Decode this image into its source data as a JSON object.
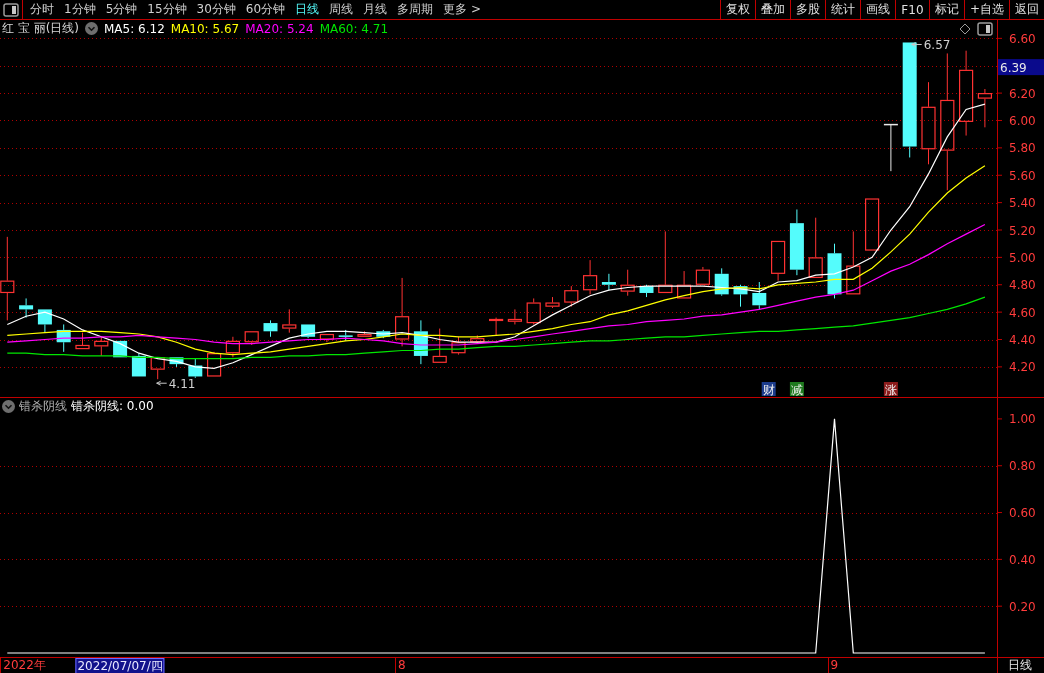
{
  "toolbar": {
    "periods": [
      {
        "label": "分时",
        "selected": false
      },
      {
        "label": "1分钟",
        "selected": false
      },
      {
        "label": "5分钟",
        "selected": false
      },
      {
        "label": "15分钟",
        "selected": false
      },
      {
        "label": "30分钟",
        "selected": false
      },
      {
        "label": "60分钟",
        "selected": false
      },
      {
        "label": "日线",
        "selected": true
      },
      {
        "label": "周线",
        "selected": false
      },
      {
        "label": "月线",
        "selected": false
      },
      {
        "label": "多周期",
        "selected": false
      },
      {
        "label": "更多 >",
        "selected": false
      }
    ],
    "buttons": [
      "复权",
      "叠加",
      "多股",
      "统计",
      "画线",
      "F10",
      "标记",
      "+自选",
      "返回"
    ]
  },
  "price_panel": {
    "title": "红 宝 丽(日线)",
    "price_tag": "6.39",
    "event_tags": [
      {
        "label": "财",
        "color": "#1c3c8c"
      },
      {
        "label": "减",
        "color": "#1f7a1f"
      },
      {
        "label": "涨",
        "color": "#8c1c1c"
      }
    ],
    "chart_data": {
      "type": "candlestick",
      "ylim": [
        3.98,
        6.61
      ],
      "grid": true,
      "yticks": [
        {
          "value": 6.6,
          "label": "6.60"
        },
        {
          "value": 6.2,
          "label": "6.20"
        },
        {
          "value": 6.0,
          "label": "6.00"
        },
        {
          "value": 5.8,
          "label": "5.80"
        },
        {
          "value": 5.6,
          "label": "5.60"
        },
        {
          "value": 5.4,
          "label": "5.40"
        },
        {
          "value": 5.2,
          "label": "5.20"
        },
        {
          "value": 5.0,
          "label": "5.00"
        },
        {
          "value": 4.8,
          "label": "4.80"
        },
        {
          "value": 4.6,
          "label": "4.60"
        },
        {
          "value": 4.4,
          "label": "4.40"
        },
        {
          "value": 4.2,
          "label": "4.20"
        }
      ],
      "ohlc": [
        [
          4.74,
          5.15,
          4.54,
          4.83
        ],
        [
          4.65,
          4.7,
          4.56,
          4.62
        ],
        [
          4.62,
          4.62,
          4.45,
          4.51
        ],
        [
          4.47,
          4.51,
          4.31,
          4.38
        ],
        [
          4.33,
          4.45,
          4.33,
          4.36
        ],
        [
          4.35,
          4.42,
          4.28,
          4.39
        ],
        [
          4.39,
          4.39,
          4.27,
          4.27
        ],
        [
          4.28,
          4.3,
          4.13,
          4.13
        ],
        [
          4.18,
          4.27,
          4.11,
          4.27
        ],
        [
          4.27,
          4.27,
          4.2,
          4.22
        ],
        [
          4.21,
          4.26,
          4.12,
          4.13
        ],
        [
          4.13,
          4.31,
          4.13,
          4.3
        ],
        [
          4.3,
          4.42,
          4.27,
          4.39
        ],
        [
          4.38,
          4.46,
          4.36,
          4.46
        ],
        [
          4.52,
          4.54,
          4.42,
          4.46
        ],
        [
          4.48,
          4.62,
          4.45,
          4.51
        ],
        [
          4.51,
          4.51,
          4.41,
          4.42
        ],
        [
          4.4,
          4.44,
          4.38,
          4.44
        ],
        [
          4.43,
          4.47,
          4.39,
          4.42
        ],
        [
          4.42,
          4.46,
          4.42,
          4.44
        ],
        [
          4.46,
          4.47,
          4.41,
          4.42
        ],
        [
          4.4,
          4.85,
          4.35,
          4.57
        ],
        [
          4.46,
          4.54,
          4.22,
          4.28
        ],
        [
          4.23,
          4.48,
          4.23,
          4.28
        ],
        [
          4.3,
          4.42,
          4.29,
          4.38
        ],
        [
          4.38,
          4.43,
          4.37,
          4.41
        ],
        [
          4.54,
          4.56,
          4.43,
          4.55
        ],
        [
          4.53,
          4.62,
          4.51,
          4.55
        ],
        [
          4.52,
          4.7,
          4.51,
          4.67
        ],
        [
          4.64,
          4.71,
          4.63,
          4.67
        ],
        [
          4.67,
          4.79,
          4.64,
          4.76
        ],
        [
          4.76,
          4.98,
          4.73,
          4.87
        ],
        [
          4.82,
          4.88,
          4.76,
          4.8
        ],
        [
          4.75,
          4.91,
          4.72,
          4.8
        ],
        [
          4.79,
          4.8,
          4.71,
          4.74
        ],
        [
          4.74,
          5.19,
          4.74,
          4.8
        ],
        [
          4.7,
          4.9,
          4.7,
          4.8
        ],
        [
          4.8,
          4.93,
          4.8,
          4.91
        ],
        [
          4.88,
          4.92,
          4.72,
          4.73
        ],
        [
          4.79,
          4.8,
          4.64,
          4.73
        ],
        [
          4.74,
          4.82,
          4.62,
          4.65
        ],
        [
          4.88,
          5.12,
          4.83,
          5.12
        ],
        [
          5.25,
          5.35,
          4.87,
          4.91
        ],
        [
          4.85,
          5.29,
          4.85,
          5.0
        ],
        [
          5.03,
          5.1,
          4.7,
          4.73
        ],
        [
          4.73,
          5.19,
          4.73,
          4.94
        ],
        [
          5.05,
          5.43,
          5.05,
          5.43
        ],
        [
          5.97,
          5.97,
          5.63,
          5.97
        ],
        [
          6.57,
          6.57,
          5.73,
          5.81
        ],
        [
          5.79,
          6.28,
          5.68,
          6.1
        ],
        [
          5.78,
          6.49,
          5.49,
          6.15
        ],
        [
          5.99,
          6.51,
          5.89,
          6.37
        ],
        [
          6.16,
          6.23,
          5.95,
          6.2
        ]
      ],
      "series": [
        {
          "name": "MA5: 6.12",
          "type": "line",
          "color": "#ffffff",
          "values": [
            4.51,
            4.57,
            4.6,
            4.55,
            4.47,
            4.42,
            4.37,
            4.3,
            4.26,
            4.24,
            4.2,
            4.19,
            4.23,
            4.29,
            4.35,
            4.41,
            4.44,
            4.46,
            4.46,
            4.45,
            4.44,
            4.45,
            4.43,
            4.4,
            4.38,
            4.38,
            4.38,
            4.42,
            4.5,
            4.58,
            4.65,
            4.72,
            4.76,
            4.78,
            4.79,
            4.79,
            4.79,
            4.79,
            4.78,
            4.77,
            4.75,
            4.82,
            4.83,
            4.87,
            4.88,
            4.93,
            5.0,
            5.2,
            5.37,
            5.61,
            5.88,
            6.08,
            6.12
          ]
        },
        {
          "name": "MA10: 5.67",
          "type": "line",
          "color": "#ffff00",
          "values": [
            4.43,
            4.44,
            4.45,
            4.46,
            4.46,
            4.46,
            4.45,
            4.44,
            4.42,
            4.38,
            4.33,
            4.3,
            4.29,
            4.3,
            4.31,
            4.33,
            4.35,
            4.37,
            4.39,
            4.4,
            4.42,
            4.44,
            4.43,
            4.43,
            4.42,
            4.42,
            4.43,
            4.44,
            4.46,
            4.48,
            4.51,
            4.53,
            4.58,
            4.61,
            4.65,
            4.69,
            4.72,
            4.75,
            4.77,
            4.78,
            4.77,
            4.8,
            4.81,
            4.82,
            4.84,
            4.84,
            4.92,
            5.04,
            5.17,
            5.33,
            5.47,
            5.58,
            5.67
          ]
        },
        {
          "name": "MA20: 5.24",
          "type": "line",
          "color": "#ff00ff",
          "values": [
            4.38,
            4.39,
            4.4,
            4.41,
            4.41,
            4.42,
            4.42,
            4.43,
            4.42,
            4.41,
            4.4,
            4.38,
            4.37,
            4.37,
            4.38,
            4.39,
            4.4,
            4.4,
            4.41,
            4.4,
            4.39,
            4.37,
            4.36,
            4.36,
            4.36,
            4.37,
            4.38,
            4.4,
            4.42,
            4.44,
            4.46,
            4.48,
            4.5,
            4.51,
            4.53,
            4.54,
            4.55,
            4.57,
            4.58,
            4.6,
            4.62,
            4.65,
            4.68,
            4.71,
            4.73,
            4.76,
            4.83,
            4.9,
            4.95,
            5.02,
            5.1,
            5.17,
            5.24
          ]
        },
        {
          "name": "MA60: 4.71",
          "type": "line",
          "color": "#00e600",
          "values": [
            4.3,
            4.3,
            4.29,
            4.29,
            4.28,
            4.28,
            4.28,
            4.27,
            4.27,
            4.26,
            4.26,
            4.26,
            4.26,
            4.27,
            4.27,
            4.28,
            4.28,
            4.29,
            4.29,
            4.3,
            4.31,
            4.32,
            4.32,
            4.33,
            4.33,
            4.34,
            4.35,
            4.35,
            4.36,
            4.37,
            4.38,
            4.39,
            4.39,
            4.4,
            4.41,
            4.42,
            4.42,
            4.43,
            4.44,
            4.45,
            4.46,
            4.46,
            4.47,
            4.48,
            4.49,
            4.5,
            4.52,
            4.54,
            4.56,
            4.59,
            4.62,
            4.66,
            4.71
          ]
        }
      ],
      "annotations": [
        {
          "text": "6.57"
        },
        {
          "text": "4.11"
        }
      ]
    }
  },
  "indicator_panel": {
    "title": "错杀阴线",
    "chart_data": {
      "type": "line",
      "ylim": [
        -0.017,
        1.021
      ],
      "grid": true,
      "yticks": [
        {
          "value": 1.0,
          "label": "1.00"
        },
        {
          "value": 0.8,
          "label": "0.80"
        },
        {
          "value": 0.6,
          "label": "0.60"
        },
        {
          "value": 0.4,
          "label": "0.40"
        },
        {
          "value": 0.2,
          "label": "0.20"
        }
      ],
      "series": [
        {
          "name": "错杀阴线: 0.00",
          "color": "#ffffff",
          "values": [
            0,
            0,
            0,
            0,
            0,
            0,
            0,
            0,
            0,
            0,
            0,
            0,
            0,
            0,
            0,
            0,
            0,
            0,
            0,
            0,
            0,
            0,
            0,
            0,
            0,
            0,
            0,
            0,
            0,
            0,
            0,
            0,
            0,
            0,
            0,
            0,
            0,
            0,
            0,
            0,
            0,
            0,
            0,
            0,
            1,
            0,
            0,
            0,
            0,
            0,
            0,
            0,
            0
          ]
        }
      ]
    }
  },
  "date_axis": {
    "labels": [
      "2022年",
      "8",
      "9"
    ],
    "cursor_date": "2022/07/07/四",
    "period": "日线"
  }
}
